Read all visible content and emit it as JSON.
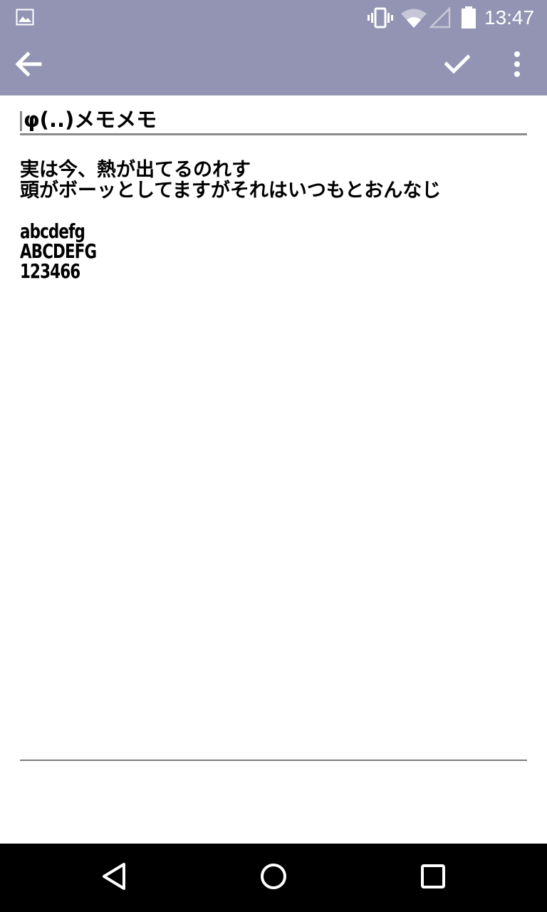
{
  "status_bar": {
    "time": "13:47",
    "icons": [
      "gallery-icon",
      "vibrate-icon",
      "wifi-icon",
      "signal-icon",
      "battery-icon"
    ],
    "background": "#9394b3"
  },
  "toolbar": {
    "background": "#9394b3",
    "icons": [
      "back-arrow-icon",
      "check-icon",
      "overflow-menu-icon"
    ]
  },
  "memo": {
    "title": "φ(..)メモメモ",
    "body": {
      "line1": "実は今、熱が出てるのれす",
      "line2": "頭がボーッとしてますがそれはいつもとおんなじ",
      "line3": "abcdefg",
      "line4": "ABCDEFG",
      "line5": "123466"
    }
  },
  "nav_bar": {
    "icons": [
      "nav-back-icon",
      "nav-home-icon",
      "nav-recents-icon"
    ]
  }
}
